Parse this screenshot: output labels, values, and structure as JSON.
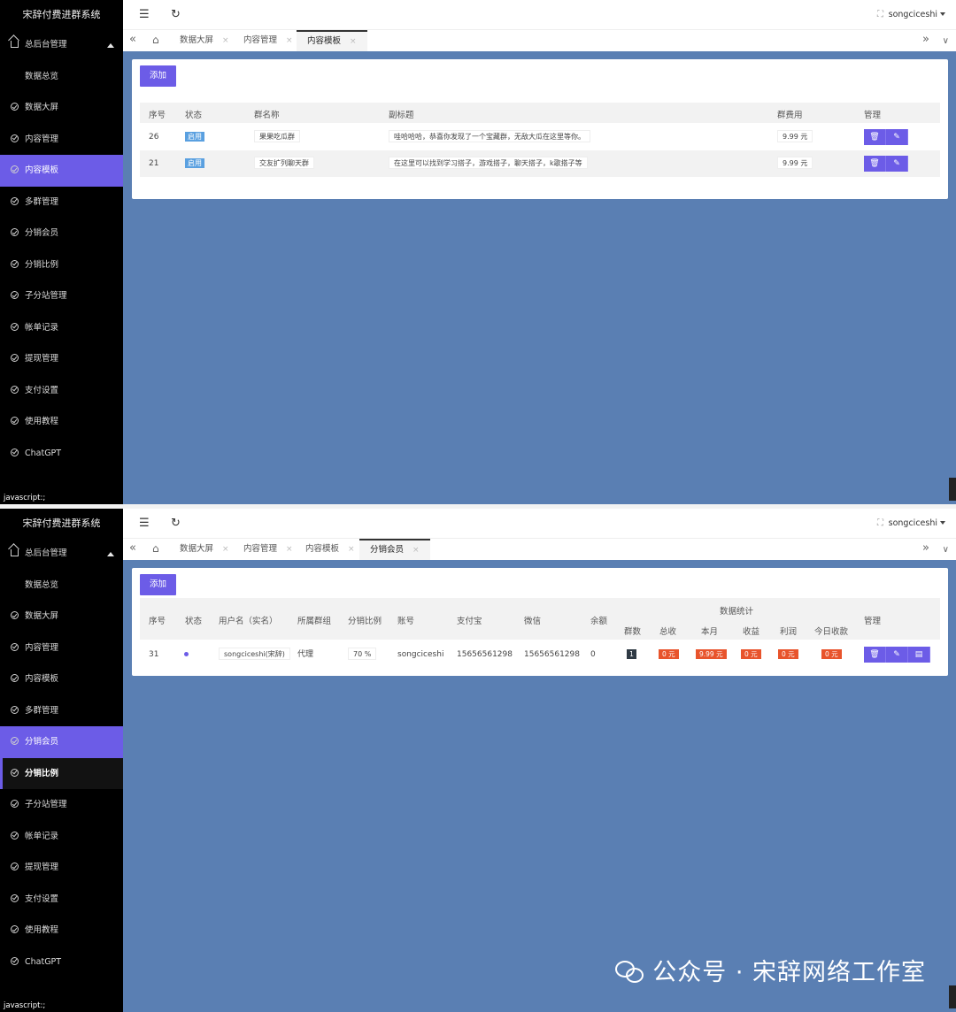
{
  "app_title": "宋辞付费进群系统",
  "status_text": "javascript:;",
  "user_name": "songciceshi",
  "watermark": "公众号 · 宋辞网络工作室",
  "menu": {
    "root": "总后台管理",
    "sub": "数据总览",
    "items": [
      "数据大屏",
      "内容管理",
      "内容模板",
      "多群管理",
      "分销会员",
      "分销比例",
      "子分站管理",
      "帐单记录",
      "提现管理",
      "支付设置",
      "使用教程",
      "ChatGPT"
    ]
  },
  "colors": {
    "accent": "#6c5ce7",
    "sidebar": "#000000",
    "background": "#5a7fb3",
    "tag_red": "#e8542c",
    "tag_blue": "#5aa0e0"
  },
  "screen1": {
    "tabs": [
      "数据大屏",
      "内容管理",
      "内容模板"
    ],
    "active_tab": "内容模板",
    "add_label": "添加",
    "headers": {
      "id": "序号",
      "status": "状态",
      "group_name": "群名称",
      "subtitle": "副标题",
      "fee": "群费用",
      "manage": "管理"
    },
    "rows": [
      {
        "id": "26",
        "status": "启用",
        "group_name": "果果吃瓜群",
        "subtitle": "哇哈哈哈，恭喜你发现了一个宝藏群，无敌大瓜在这里等你。",
        "fee": "9.99 元"
      },
      {
        "id": "21",
        "status": "启用",
        "group_name": "交友扩列聊天群",
        "subtitle": "在这里可以找到学习搭子，游戏搭子，聊天搭子，k歌搭子等",
        "fee": "9.99 元"
      }
    ]
  },
  "screen2": {
    "tabs": [
      "数据大屏",
      "内容管理",
      "内容模板",
      "分销会员"
    ],
    "active_tab": "分销会员",
    "add_label": "添加",
    "headers": {
      "id": "序号",
      "status": "状态",
      "username": "用户名（实名）",
      "group": "所属群组",
      "ratio": "分销比例",
      "account": "账号",
      "alipay": "支付宝",
      "wechat": "微信",
      "balance": "余额",
      "stats": "数据统计",
      "group_count": "群数",
      "total": "总收",
      "month": "本月",
      "income": "收益",
      "profit": "利润",
      "today": "今日收款",
      "manage": "管理"
    },
    "rows": [
      {
        "id": "31",
        "username": "songciceshi(宋辞)",
        "group": "代理",
        "ratio": "70 %",
        "account": "songciceshi",
        "alipay": "15656561298",
        "wechat": "15656561298",
        "balance": "0",
        "group_count": "1",
        "total": "0 元",
        "month": "9.99 元",
        "income": "0 元",
        "profit": "0 元",
        "today": "0 元"
      }
    ]
  }
}
